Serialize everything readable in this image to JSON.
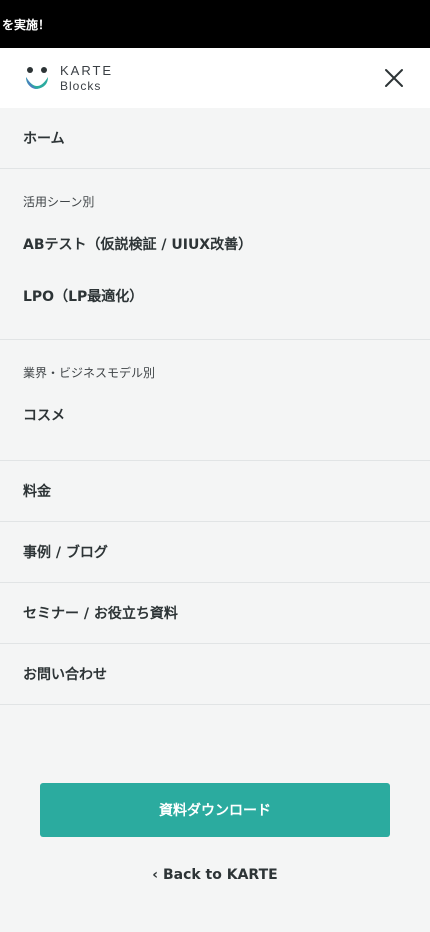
{
  "announcement": {
    "text": "を実施！"
  },
  "header": {
    "logo_title": "KARTE",
    "logo_sub": "Blocks",
    "close_icon": "close-icon"
  },
  "menu": {
    "home": "ホーム",
    "use_case": {
      "label": "活用シーン別",
      "items": [
        "ABテスト（仮説検証 / UIUX改善）",
        "LPO（LP最適化）"
      ]
    },
    "industry": {
      "label": "業界・ビジネスモデル別",
      "items": [
        "コスメ"
      ]
    },
    "pricing": "料金",
    "cases": "事例 / ブログ",
    "seminar": "セミナー / お役立ち資料",
    "contact": "お問い合わせ"
  },
  "cta": {
    "download_label": "資料ダウンロード"
  },
  "back": {
    "chevron": "‹",
    "label": "Back to KARTE"
  },
  "colors": {
    "accent": "#2bab9f",
    "announce_bg": "#000000"
  }
}
